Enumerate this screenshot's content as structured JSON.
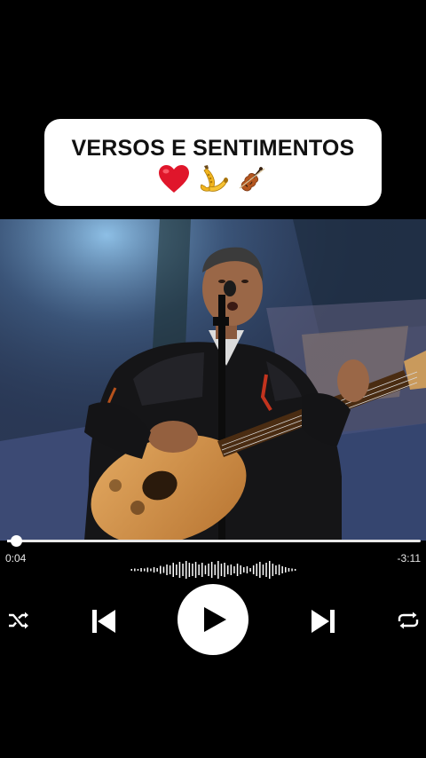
{
  "title_card": {
    "text": "VERSOS E SENTIMENTOS",
    "emojis": [
      "red-heart",
      "saxophone",
      "violin"
    ]
  },
  "video": {
    "scene": "performer-singing-with-guitar"
  },
  "player": {
    "elapsed": "0:04",
    "remaining": "-3:11",
    "progress_fraction": 0.022,
    "controls": [
      "shuffle-icon",
      "previous-icon",
      "play-icon",
      "next-icon",
      "repeat-icon"
    ]
  },
  "colors": {
    "background": "#000000",
    "card": "#ffffff",
    "title_text": "#111111",
    "controls": "#ffffff"
  }
}
